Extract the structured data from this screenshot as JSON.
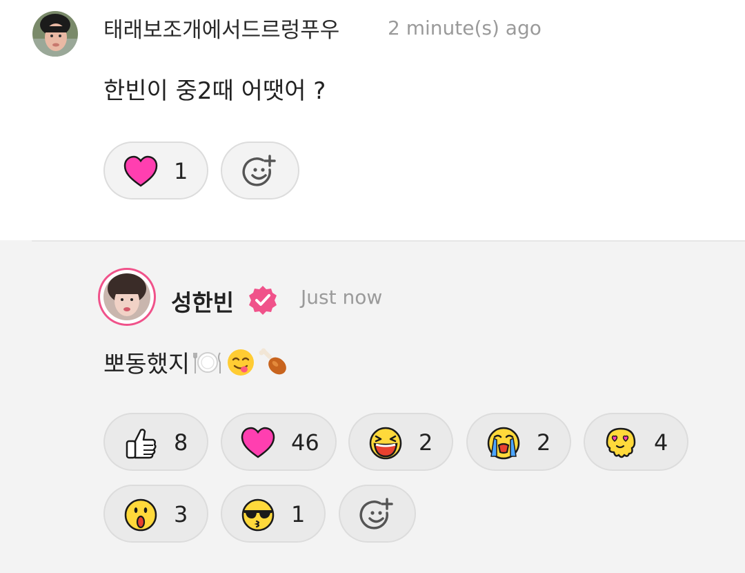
{
  "comment": {
    "author": "태래보조개에서드르렁푸우",
    "time": "2 minute(s) ago",
    "text": "한빈이 중2때 어땟어 ?",
    "reactions": [
      {
        "icon": "heart-icon",
        "count": "1"
      }
    ],
    "add_reaction_icon": "add-reaction-icon"
  },
  "reply": {
    "author": "성한빈",
    "verified_icon": "verified-badge-icon",
    "time": "Just now",
    "text": "뽀동했지",
    "text_emojis": [
      "plate-fork-icon",
      "yum-face-icon",
      "drumstick-icon"
    ],
    "reactions": [
      {
        "icon": "thumbs-up-icon",
        "count": "8"
      },
      {
        "icon": "heart-icon",
        "count": "46"
      },
      {
        "icon": "laughing-face-icon",
        "count": "2"
      },
      {
        "icon": "crying-face-icon",
        "count": "2"
      },
      {
        "icon": "heart-eyes-melting-icon",
        "count": "4"
      },
      {
        "icon": "surprised-face-icon",
        "count": "3"
      },
      {
        "icon": "sunglasses-kiss-icon",
        "count": "1"
      }
    ],
    "add_reaction_icon": "add-reaction-icon"
  },
  "colors": {
    "heart": "#ff3fb0",
    "verified": "#f0528a",
    "emoji_yellow": "#ffd93b",
    "reply_background": "#f3f3f3"
  }
}
